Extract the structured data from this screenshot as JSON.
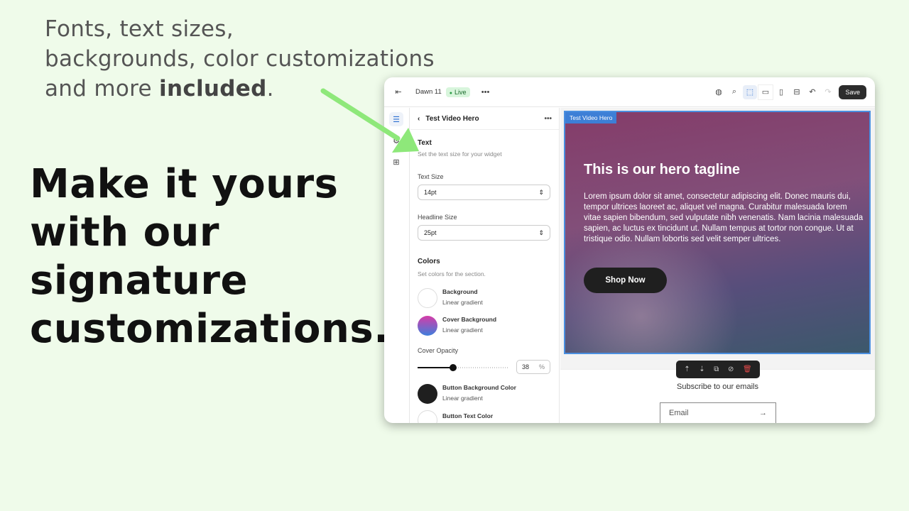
{
  "intro": {
    "line1": "Fonts, text sizes,",
    "line2": "backgrounds, color customizations",
    "line3_pre": "and more ",
    "line3_bold": "included",
    "line3_post": "."
  },
  "headline": {
    "l1": "Make it yours",
    "l2": "with our",
    "l3": "signature",
    "l4": "customizations."
  },
  "topbar": {
    "theme": "Dawn 11",
    "status": "Live",
    "save": "Save"
  },
  "panel": {
    "title": "Test Video Hero",
    "text_section": "Text",
    "text_desc": "Set the text size for your widget",
    "text_size_label": "Text Size",
    "text_size": "14pt",
    "headline_size_label": "Headline Size",
    "headline_size": "25pt",
    "colors_section": "Colors",
    "colors_desc": "Set colors for the section.",
    "swatches": [
      {
        "name": "Background",
        "type": "Linear gradient",
        "color": "#ffffff"
      },
      {
        "name": "Cover Background",
        "type": "Linear gradient",
        "color": "linear-gradient(#d63ca8,#3f7fdc)"
      },
      {
        "name": "Button Background Color",
        "type": "Linear gradient",
        "color": "#1f1f1f"
      },
      {
        "name": "Button Text Color",
        "type": "",
        "color": "#ffffff"
      }
    ],
    "opacity_label": "Cover Opacity",
    "opacity": "38",
    "opacity_unit": "%"
  },
  "preview": {
    "section_tag": "Test Video Hero",
    "hero_title": "This is our hero tagline",
    "hero_body": "Lorem ipsum dolor sit amet, consectetur adipiscing elit. Donec mauris dui, tempor ultrices laoreet ac, aliquet vel magna. Curabitur malesuada lorem vitae sapien bibendum, sed vulputate nibh venenatis. Nam lacinia malesuada sapien, ac luctus ex tincidunt ut. Nullam tempus at tortor non congue. Ut at tristique odio. Nullam lobortis sed velit semper ultrices.",
    "hero_button": "Shop Now",
    "subscribe": "Subscribe to our emails",
    "email_placeholder": "Email"
  },
  "colors": {
    "background": "#effbea",
    "arrow": "#8ee87a",
    "accent": "#3d7fd6"
  }
}
